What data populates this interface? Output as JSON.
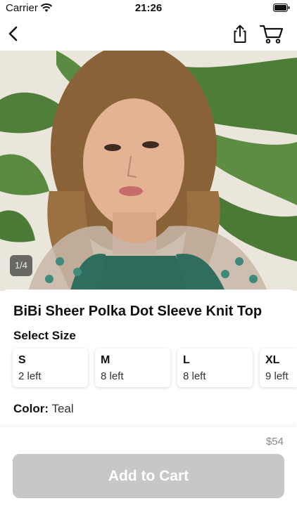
{
  "status_bar": {
    "carrier": "Carrier",
    "time": "21:26"
  },
  "nav": {
    "icons": [
      "chevron-left-icon",
      "share-icon",
      "cart-icon"
    ]
  },
  "gallery": {
    "page_indicator": "1/4",
    "current": 1,
    "total": 4
  },
  "product": {
    "title": "BiBi Sheer Polka Dot Sleeve Knit Top",
    "select_size_label": "Select Size",
    "sizes": [
      {
        "name": "S",
        "stock": "2 left"
      },
      {
        "name": "M",
        "stock": "8 left"
      },
      {
        "name": "L",
        "stock": "8 left"
      },
      {
        "name": "XL",
        "stock": "9 left"
      }
    ],
    "color_label": "Color:",
    "color_value": "Teal"
  },
  "footer": {
    "price": "$54",
    "add_to_cart": "Add to Cart"
  },
  "colors": {
    "button_disabled": "#c7c7c7",
    "price_text": "#8a8a8a",
    "indicator_bg": "#3c3c3c"
  }
}
